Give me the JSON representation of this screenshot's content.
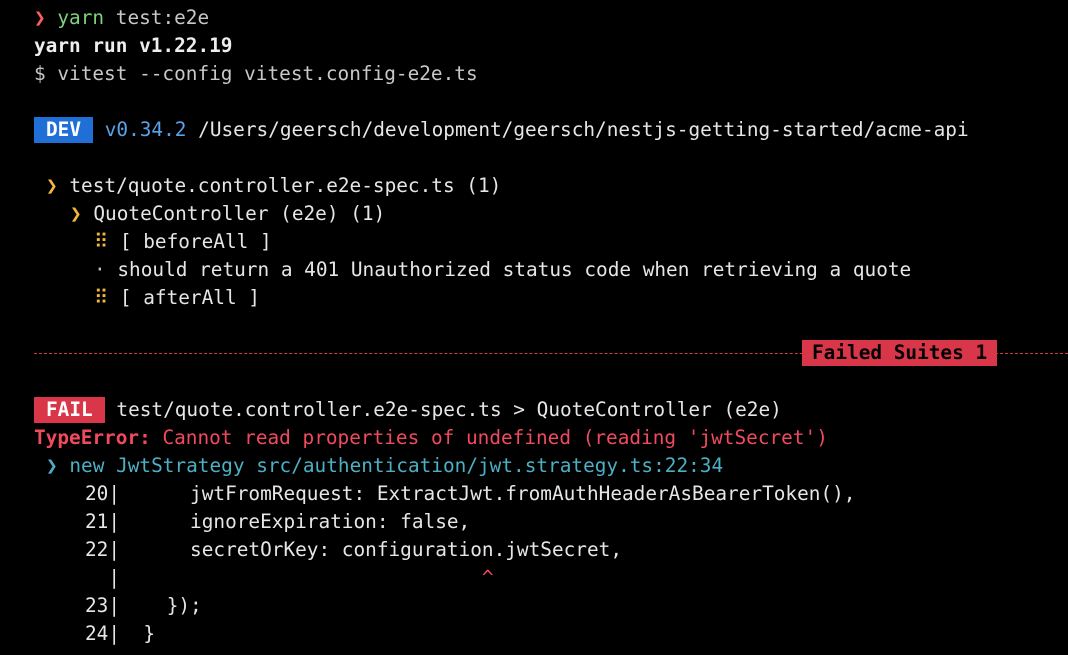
{
  "lines": {
    "cmd_prompt_symbol": "❯",
    "cmd_program": "yarn",
    "cmd_args": "test:e2e",
    "yarn_run": "yarn run v1.22.19",
    "vitest_cmd": "$ vitest --config vitest.config-e2e.ts",
    "dev_badge": "DEV",
    "version": "v0.34.2",
    "project_path": "/Users/geersch/development/geersch/nestjs-getting-started/acme-api",
    "suite_chevron": "❯",
    "suite_file": "test/quote.controller.e2e-spec.ts (1)",
    "describe_chevron": "❯",
    "describe_name": "QuoteController (e2e) (1)",
    "hook_symbol": "⠿",
    "before_all": "[ beforeAll ]",
    "test_bullet": "·",
    "test_name": "should return a 401 Unauthorized status code when retrieving a quote",
    "after_all": "[ afterAll ]"
  },
  "summary": {
    "failed_suites_label": "Failed Suites 1"
  },
  "failure": {
    "fail_badge": "FAIL",
    "fail_path": "test/quote.controller.e2e-spec.ts > QuoteController (e2e)",
    "error_type": "TypeError:",
    "error_message": "Cannot read properties of undefined (reading 'jwtSecret')",
    "stack_chevron": "❯",
    "stack_fn": "new JwtStrategy",
    "stack_location": "src/authentication/jwt.strategy.ts:22:34",
    "code_lines": [
      {
        "num": "20|",
        "code": "      jwtFromRequest: ExtractJwt.fromAuthHeaderAsBearerToken(),"
      },
      {
        "num": "21|",
        "code": "      ignoreExpiration: false,"
      },
      {
        "num": "22|",
        "code": "      secretOrKey: configuration.jwtSecret,"
      },
      {
        "num": "|",
        "code": "                               ^"
      },
      {
        "num": "23|",
        "code": "    });"
      },
      {
        "num": "24|",
        "code": "  }"
      }
    ]
  },
  "colors": {
    "background": "#000000",
    "prompt": "#ff5f5f",
    "green": "#7ed37e",
    "blue": "#1f6fd6",
    "yellow": "#f5b83b",
    "red": "#d9364a",
    "cyan": "#4cb0c4"
  }
}
